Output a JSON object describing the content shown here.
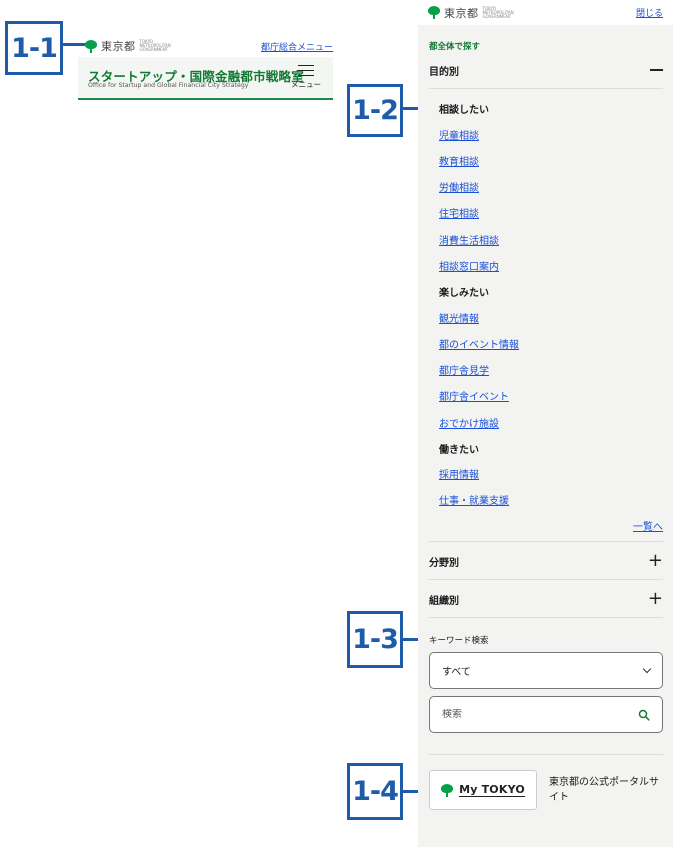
{
  "callouts": [
    "1-1",
    "1-2",
    "1-3",
    "1-4"
  ],
  "logo": {
    "text": "東京都",
    "sub": "TOKYO METROPOLITAN GOVERNMENT"
  },
  "left_screen": {
    "menu_link": "都庁総合メニュー",
    "site_title": "スタートアップ・国際金融都市戦略室",
    "site_subtitle": "Office for Startup and Global Financial City Strategy",
    "menu_label": "メニュー"
  },
  "panel": {
    "close_label": "閉じる",
    "find_label": "都全体で探す",
    "accordions": {
      "purpose": "目的別",
      "field": "分野別",
      "organization": "組織別"
    },
    "groups": [
      {
        "heading": "相談したい",
        "links": [
          "児童相談",
          "教育相談",
          "労働相談",
          "住宅相談",
          "消費生活相談",
          "相談窓口案内"
        ]
      },
      {
        "heading": "楽しみたい",
        "links": [
          "観光情報",
          "都のイベント情報",
          "都庁舎見学",
          "都庁舎イベント",
          "おでかけ施設"
        ]
      },
      {
        "heading": "働きたい",
        "links": [
          "採用情報",
          "仕事・就業支援"
        ]
      }
    ],
    "list_more": "一覧へ",
    "keyword_label": "キーワード検索",
    "select_value": "すべて",
    "search_placeholder": "検索",
    "mytokyo": {
      "brand": "My TOKYO",
      "description": "東京都の公式ポータルサイト"
    }
  },
  "colors": {
    "accent_green": "#117a34",
    "callout_blue": "#1f5ba8",
    "link_blue": "#1a4fd6"
  }
}
